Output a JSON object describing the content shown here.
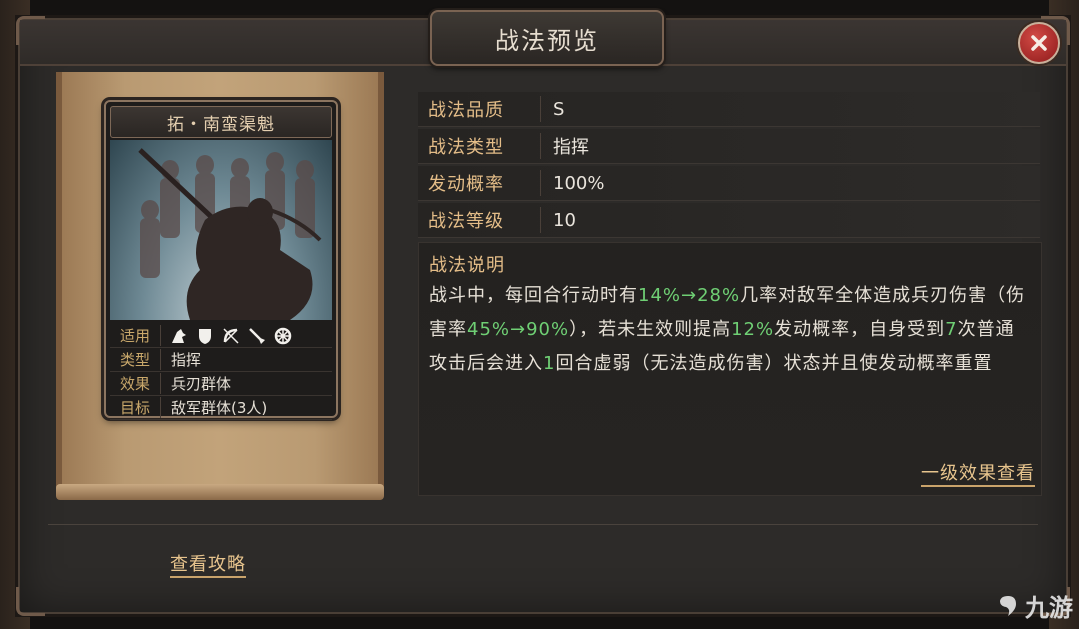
{
  "window": {
    "title": "战法预览"
  },
  "card": {
    "name": "拓・南蛮渠魁",
    "rows": [
      {
        "label": "适用",
        "type": "icons",
        "icons": [
          "cavalry-icon",
          "shield-icon",
          "bow-icon",
          "spear-icon",
          "siege-icon"
        ]
      },
      {
        "label": "类型",
        "value": "指挥"
      },
      {
        "label": "效果",
        "value": "兵刃群体"
      },
      {
        "label": "目标",
        "value": "敌军群体(3人)"
      }
    ]
  },
  "details": [
    {
      "label": "战法品质",
      "value": "S"
    },
    {
      "label": "战法类型",
      "value": "指挥"
    },
    {
      "label": "发动概率",
      "value": "100%"
    },
    {
      "label": "战法等级",
      "value": "10"
    }
  ],
  "description": {
    "title": "战法说明",
    "segments": [
      {
        "text": "战斗中，每回合行动时有",
        "highlight": false
      },
      {
        "text": "14%→28%",
        "highlight": true
      },
      {
        "text": "几率对敌军全体造成兵刃伤害（伤害率",
        "highlight": false
      },
      {
        "text": "45%→90%",
        "highlight": true
      },
      {
        "text": "），若未生效则提高",
        "highlight": false
      },
      {
        "text": "12%",
        "highlight": true
      },
      {
        "text": "发动概率，自身受到",
        "highlight": false
      },
      {
        "text": "7",
        "highlight": true
      },
      {
        "text": "次普通攻击后会进入",
        "highlight": false
      },
      {
        "text": "1",
        "highlight": true
      },
      {
        "text": "回合虚弱（无法造成伤害）状态并且使发动概率重置",
        "highlight": false
      }
    ],
    "level_link": "一级效果查看"
  },
  "footer": {
    "guide_link": "查看攻略"
  },
  "watermark": {
    "text": "九游"
  },
  "colors": {
    "highlight": "#6fcf74",
    "label": "#e4bd88",
    "link": "#e7c48d"
  }
}
